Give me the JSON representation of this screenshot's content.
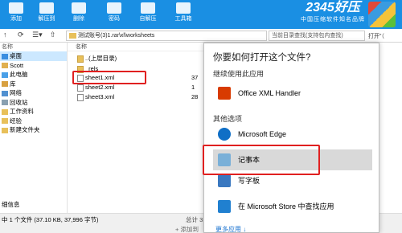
{
  "toolbar": {
    "buttons": [
      "添加",
      "解压到",
      "删除",
      "密码",
      "自解压",
      "工具箱"
    ],
    "brand_title": "2345好压",
    "brand_slogan": "中国压缩软件知名品牌"
  },
  "address": {
    "path": "测试账号(3)1.rar\\xl\\worksheets",
    "search_placeholder": "当前目录查找(支持包内查找)",
    "extra": "打开”（"
  },
  "leftnav": {
    "header": "名称",
    "items": [
      "桌面",
      "Scott",
      "此电脑",
      "库",
      "网络",
      "回收站",
      "工作资料",
      "经验",
      "新建文件夹"
    ],
    "footer": "细信息"
  },
  "files": {
    "column_name": "名称",
    "rows": [
      {
        "name": "..(上层目录)",
        "num": ""
      },
      {
        "name": "_rels",
        "num": ""
      },
      {
        "name": "sheet1.xml",
        "num": "37"
      },
      {
        "name": "sheet2.xml",
        "num": "1"
      },
      {
        "name": "sheet3.xml",
        "num": "28"
      }
    ]
  },
  "status": {
    "left": "中 1 个文件 (37.10 KB, 37,996 字节)",
    "right": "总计 3",
    "add": "+ 添加到"
  },
  "dialog": {
    "title": "你要如何打开这个文件?",
    "continue_label": "继续使用此应用",
    "other_label": "其他选项",
    "apps": [
      {
        "name": "Office XML Handler",
        "color": "#d83b01"
      },
      {
        "name": "Microsoft Edge",
        "color": "#0f6fc6"
      },
      {
        "name": "记事本",
        "color": "#7ab0d8"
      },
      {
        "name": "写字板",
        "color": "#3a78c0"
      },
      {
        "name": "在 Microsoft Store 中查找应用",
        "color": "#2080d0"
      }
    ],
    "more": "更多应用 ↓"
  },
  "colors": {
    "toolbar": "#1a8fe3",
    "highlight": "#e02020",
    "selection": "#cce8ff"
  }
}
